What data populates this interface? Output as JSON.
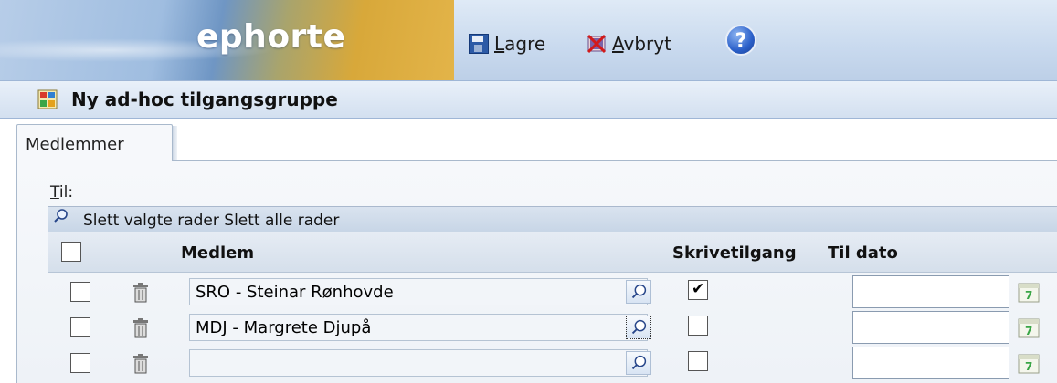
{
  "app": {
    "logo": "ephorte"
  },
  "toolbar": {
    "save_prefix": "",
    "save_accel": "L",
    "save_rest": "agre",
    "cancel_accel": "A",
    "cancel_rest": "vbryt",
    "help_glyph": "?"
  },
  "page": {
    "title": "Ny ad-hoc tilgangsgruppe"
  },
  "tabs": [
    {
      "label": "Medlemmer",
      "active": true
    }
  ],
  "form": {
    "til_accel": "T",
    "til_rest": "il:",
    "table_actions": "Slett valgte rader Slett alle rader",
    "columns": {
      "member": "Medlem",
      "write_access": "Skrivetilgang",
      "to_date": "Til dato"
    },
    "rows": [
      {
        "member": "SRO - Steinar Rønhovde",
        "write_access": true,
        "to_date": "",
        "lookup_focused": false
      },
      {
        "member": "MDJ - Margrete Djupå",
        "write_access": false,
        "to_date": "",
        "lookup_focused": true
      },
      {
        "member": "",
        "write_access": false,
        "to_date": "",
        "lookup_focused": false
      }
    ],
    "calendar_glyph": "7"
  },
  "colors": {
    "accent_blue": "#2a5fc9",
    "header_bg": "#c8d9ee",
    "panel_bg": "#eef2f7"
  }
}
